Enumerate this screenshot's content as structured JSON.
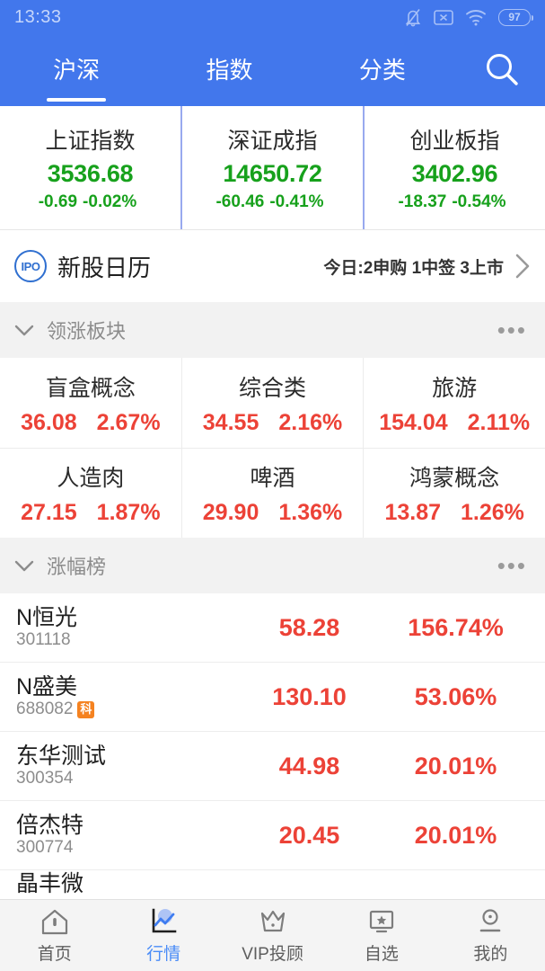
{
  "status_bar": {
    "time": "13:33",
    "battery_level": "97",
    "icons": [
      "bell-muted-icon",
      "x-box-icon",
      "wifi-icon",
      "battery-icon"
    ]
  },
  "header": {
    "tabs": [
      {
        "label": "沪深",
        "active": true
      },
      {
        "label": "指数",
        "active": false
      },
      {
        "label": "分类",
        "active": false
      }
    ],
    "search_icon": "search-icon",
    "background_color": "#4277ec"
  },
  "indices": [
    {
      "name": "上证指数",
      "value": "3536.68",
      "change": "-0.69",
      "percent": "-0.02%"
    },
    {
      "name": "深证成指",
      "value": "14650.72",
      "change": "-60.46",
      "percent": "-0.41%"
    },
    {
      "name": "创业板指",
      "value": "3402.96",
      "change": "-18.37",
      "percent": "-0.54%"
    }
  ],
  "ipo": {
    "badge": "IPO",
    "title": "新股日历",
    "summary": "今日:2申购 1中签 3上市",
    "chevron": "chevron-right-icon"
  },
  "sectors_section": {
    "title": "领涨板块",
    "collapse_icon": "chevron-down-icon",
    "more_icon": "ellipsis-icon",
    "items": [
      {
        "name": "盲盒概念",
        "value": "36.08",
        "percent": "2.67%"
      },
      {
        "name": "综合类",
        "value": "34.55",
        "percent": "2.16%"
      },
      {
        "name": "旅游",
        "value": "154.04",
        "percent": "2.11%"
      },
      {
        "name": "人造肉",
        "value": "27.15",
        "percent": "1.87%"
      },
      {
        "name": "啤酒",
        "value": "29.90",
        "percent": "1.36%"
      },
      {
        "name": "鸿蒙概念",
        "value": "13.87",
        "percent": "1.26%"
      }
    ]
  },
  "gainers_section": {
    "title": "涨幅榜",
    "collapse_icon": "chevron-down-icon",
    "more_icon": "ellipsis-icon",
    "rows": [
      {
        "name": "N恒光",
        "code": "301118",
        "tag": "",
        "price": "58.28",
        "percent": "156.74%"
      },
      {
        "name": "N盛美",
        "code": "688082",
        "tag": "科",
        "price": "130.10",
        "percent": "53.06%"
      },
      {
        "name": "东华测试",
        "code": "300354",
        "tag": "",
        "price": "44.98",
        "percent": "20.01%"
      },
      {
        "name": "倍杰特",
        "code": "300774",
        "tag": "",
        "price": "20.45",
        "percent": "20.01%"
      }
    ],
    "clipped_row": {
      "name": "晶丰微"
    }
  },
  "bottom_nav": [
    {
      "label": "首页",
      "icon": "home-icon",
      "active": false
    },
    {
      "label": "行情",
      "icon": "chart-icon",
      "active": true
    },
    {
      "label": "VIP投顾",
      "icon": "crown-icon",
      "active": false
    },
    {
      "label": "自选",
      "icon": "monitor-star-icon",
      "active": false
    },
    {
      "label": "我的",
      "icon": "user-icon",
      "active": false
    }
  ],
  "colors": {
    "brand_blue": "#4277ec",
    "up_red": "#ec4237",
    "down_green": "#17a11c",
    "accent_orange": "#f58220",
    "active_nav": "#4a8cf7"
  }
}
